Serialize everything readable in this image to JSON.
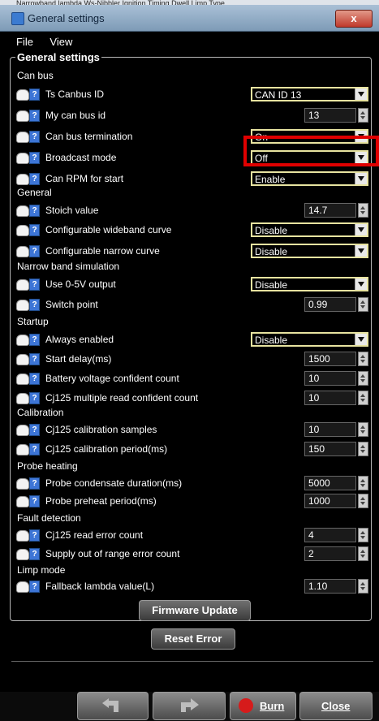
{
  "window": {
    "title": "General settings",
    "close_glyph": "x",
    "top_strip": "Narrowband lambda Ws-Nibbler Ignition Timing Dwell Limp Type"
  },
  "menu": {
    "file": "File",
    "view": "View"
  },
  "group": {
    "title": "General settings"
  },
  "sections": {
    "can_bus": "Can bus",
    "general": "General",
    "narrow_band": "Narrow band simulation",
    "startup": "Startup",
    "calibration": "Calibration",
    "probe_heating": "Probe heating",
    "fault_detection": "Fault detection",
    "limp_mode": "Limp mode"
  },
  "help_glyph": "?",
  "rows": [
    {
      "label": "Ts Canbus ID",
      "value": "CAN ID 13"
    },
    {
      "label": "My can bus id",
      "value": "13"
    },
    {
      "label": "Can bus termination",
      "value": "On"
    },
    {
      "label": "Broadcast mode",
      "value": "Off"
    },
    {
      "label": "Can RPM for start",
      "value": "Enable"
    },
    {
      "label": "Stoich value",
      "value": "14.7"
    },
    {
      "label": "Configurable wideband curve",
      "value": "Disable"
    },
    {
      "label": "Configurable narrow curve",
      "value": "Disable"
    },
    {
      "label": "Use 0-5V output",
      "value": "Disable"
    },
    {
      "label": "Switch point",
      "value": "0.99"
    },
    {
      "label": "Always enabled",
      "value": "Disable"
    },
    {
      "label": "Start delay(ms)",
      "value": "1500"
    },
    {
      "label": "Battery voltage confident count",
      "value": "10"
    },
    {
      "label": "Cj125 multiple read confident count",
      "value": "10"
    },
    {
      "label": "Cj125 calibration samples",
      "value": "10"
    },
    {
      "label": "Cj125 calibration period(ms)",
      "value": "150"
    },
    {
      "label": "Probe condensate duration(ms)",
      "value": "5000"
    },
    {
      "label": "Probe preheat period(ms)",
      "value": "1000"
    },
    {
      "label": "Cj125 read error count",
      "value": "4"
    },
    {
      "label": "Supply out of range error count",
      "value": "2"
    },
    {
      "label": "Fallback lambda value(L)",
      "value": "1.10"
    }
  ],
  "buttons": {
    "firmware_update": "Firmware Update",
    "reset_error": "Reset Error",
    "burn": "Burn",
    "close": "Close"
  },
  "colors": {
    "highlight": "#e00000",
    "field_border": "#e7e3a0",
    "help_blue": "#3d75d6"
  }
}
